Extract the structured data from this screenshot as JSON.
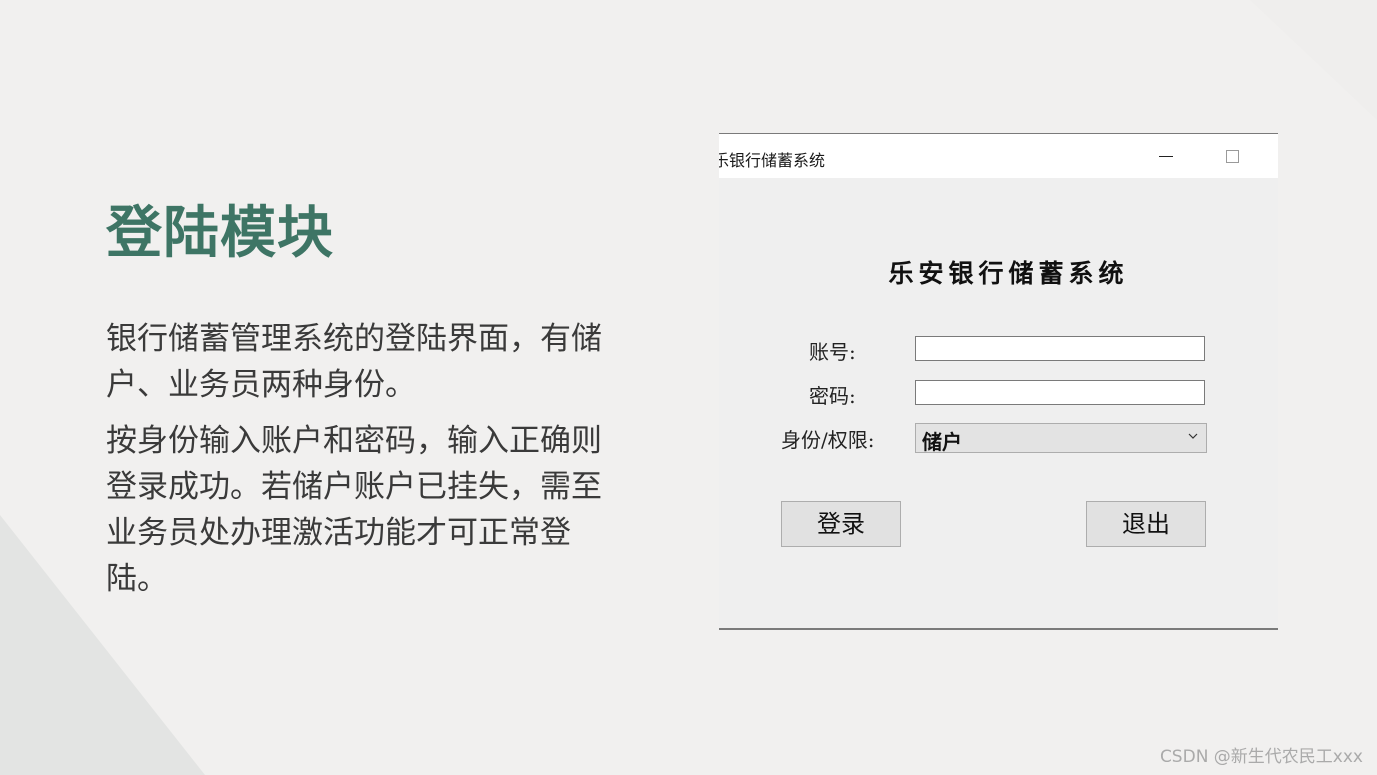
{
  "slide": {
    "title": "登陆模块",
    "paragraphs": [
      "银行储蓄管理系统的登陆界面，有储户、业务员两种身份。",
      "按身份输入账户和密码，输入正确则登录成功。若储户账户已挂失，需至业务员处办理激活功能才可正常登陆。"
    ],
    "watermark": "CSDN @新生代农民工xxx",
    "colors": {
      "title": "#3e7565",
      "background": "#f1f0ef"
    }
  },
  "app_window": {
    "title": "乐安银行储蓄系统",
    "title_visible": "乐银行储蓄系统",
    "controls": {
      "minimize_icon": "minimize-icon",
      "maximize_icon": "maximize-icon"
    },
    "form": {
      "heading": "乐安银行储蓄系统",
      "account_label": "账号:",
      "account_value": "",
      "password_label": "密码:",
      "password_value": "",
      "role_label": "身份/权限:",
      "role_selected": "储户",
      "login_button": "登录",
      "exit_button": "退出"
    }
  }
}
